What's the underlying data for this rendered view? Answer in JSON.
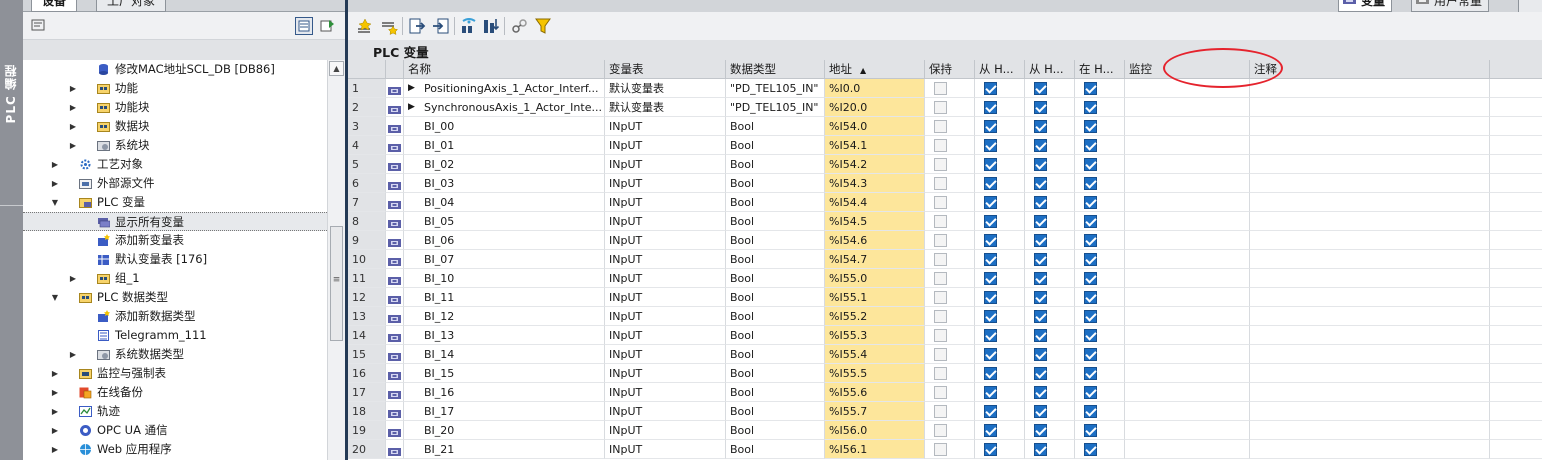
{
  "side_tab": {
    "label": "PLC 编程"
  },
  "left_tabs": {
    "devices": "设备",
    "tech_objects": "工厂对象"
  },
  "tree": [
    {
      "label": "修改MAC地址SCL_DB [DB86]",
      "indent": 3,
      "expand": "",
      "icon": "db-icon"
    },
    {
      "label": "功能",
      "indent": 3,
      "expand": "▶",
      "icon": "folder-icon"
    },
    {
      "label": "功能块",
      "indent": 3,
      "expand": "▶",
      "icon": "folder-icon"
    },
    {
      "label": "数据块",
      "indent": 3,
      "expand": "▶",
      "icon": "folder-icon"
    },
    {
      "label": "系统块",
      "indent": 3,
      "expand": "▶",
      "icon": "system-icon"
    },
    {
      "label": "工艺对象",
      "indent": 2,
      "expand": "▶",
      "icon": "tech-icon"
    },
    {
      "label": "外部源文件",
      "indent": 2,
      "expand": "▶",
      "icon": "file-icon"
    },
    {
      "label": "PLC 变量",
      "indent": 2,
      "expand": "▼",
      "icon": "tag-folder-icon"
    },
    {
      "label": "显示所有变量",
      "indent": 3,
      "expand": "",
      "icon": "tags-icon",
      "selected": true
    },
    {
      "label": "添加新变量表",
      "indent": 3,
      "expand": "",
      "icon": "add-table-icon"
    },
    {
      "label": "默认变量表 [176]",
      "indent": 3,
      "expand": "",
      "icon": "table-icon"
    },
    {
      "label": "组_1",
      "indent": 3,
      "expand": "▶",
      "icon": "folder-icon"
    },
    {
      "label": "PLC 数据类型",
      "indent": 2,
      "expand": "▼",
      "icon": "folder-icon"
    },
    {
      "label": "添加新数据类型",
      "indent": 3,
      "expand": "",
      "icon": "add-type-icon"
    },
    {
      "label": "Telegramm_111",
      "indent": 3,
      "expand": "",
      "icon": "type-icon"
    },
    {
      "label": "系统数据类型",
      "indent": 3,
      "expand": "▶",
      "icon": "system-icon"
    },
    {
      "label": "监控与强制表",
      "indent": 2,
      "expand": "▶",
      "icon": "watch-icon"
    },
    {
      "label": "在线备份",
      "indent": 2,
      "expand": "▶",
      "icon": "backup-icon"
    },
    {
      "label": "轨迹",
      "indent": 2,
      "expand": "▶",
      "icon": "trace-icon"
    },
    {
      "label": "OPC UA 通信",
      "indent": 2,
      "expand": "▶",
      "icon": "opc-icon"
    },
    {
      "label": "Web 应用程序",
      "indent": 2,
      "expand": "▶",
      "icon": "web-icon"
    }
  ],
  "right_tabs": {
    "tags": "变量",
    "user_constants": "用户常量"
  },
  "section_title": "PLC 变量",
  "columns": {
    "name": "名称",
    "table": "变量表",
    "type": "数据类型",
    "address": "地址",
    "retain": "保持",
    "from_hmi_1": "从 H...",
    "from_hmi_2": "从 H...",
    "in_hmi": "在 H...",
    "monitor": "监控",
    "comment": "注释"
  },
  "rows": [
    {
      "n": "1",
      "name": "PositioningAxis_1_Actor_Interf...",
      "expand": true,
      "table": "默认变量表",
      "type": "\"PD_TEL105_IN\"",
      "addr": "%I0.0"
    },
    {
      "n": "2",
      "name": "SynchronousAxis_1_Actor_Inte...",
      "expand": true,
      "table": "默认变量表",
      "type": "\"PD_TEL105_IN\"",
      "addr": "%I20.0"
    },
    {
      "n": "3",
      "name": "BI_00",
      "expand": false,
      "table": "INpUT",
      "type": "Bool",
      "addr": "%I54.0"
    },
    {
      "n": "4",
      "name": "BI_01",
      "expand": false,
      "table": "INpUT",
      "type": "Bool",
      "addr": "%I54.1"
    },
    {
      "n": "5",
      "name": "BI_02",
      "expand": false,
      "table": "INpUT",
      "type": "Bool",
      "addr": "%I54.2"
    },
    {
      "n": "6",
      "name": "BI_03",
      "expand": false,
      "table": "INpUT",
      "type": "Bool",
      "addr": "%I54.3"
    },
    {
      "n": "7",
      "name": "BI_04",
      "expand": false,
      "table": "INpUT",
      "type": "Bool",
      "addr": "%I54.4"
    },
    {
      "n": "8",
      "name": "BI_05",
      "expand": false,
      "table": "INpUT",
      "type": "Bool",
      "addr": "%I54.5"
    },
    {
      "n": "9",
      "name": "BI_06",
      "expand": false,
      "table": "INpUT",
      "type": "Bool",
      "addr": "%I54.6"
    },
    {
      "n": "10",
      "name": "BI_07",
      "expand": false,
      "table": "INpUT",
      "type": "Bool",
      "addr": "%I54.7"
    },
    {
      "n": "11",
      "name": "BI_10",
      "expand": false,
      "table": "INpUT",
      "type": "Bool",
      "addr": "%I55.0"
    },
    {
      "n": "12",
      "name": "BI_11",
      "expand": false,
      "table": "INpUT",
      "type": "Bool",
      "addr": "%I55.1"
    },
    {
      "n": "13",
      "name": "BI_12",
      "expand": false,
      "table": "INpUT",
      "type": "Bool",
      "addr": "%I55.2"
    },
    {
      "n": "14",
      "name": "BI_13",
      "expand": false,
      "table": "INpUT",
      "type": "Bool",
      "addr": "%I55.3"
    },
    {
      "n": "15",
      "name": "BI_14",
      "expand": false,
      "table": "INpUT",
      "type": "Bool",
      "addr": "%I55.4"
    },
    {
      "n": "16",
      "name": "BI_15",
      "expand": false,
      "table": "INpUT",
      "type": "Bool",
      "addr": "%I55.5"
    },
    {
      "n": "17",
      "name": "BI_16",
      "expand": false,
      "table": "INpUT",
      "type": "Bool",
      "addr": "%I55.6"
    },
    {
      "n": "18",
      "name": "BI_17",
      "expand": false,
      "table": "INpUT",
      "type": "Bool",
      "addr": "%I55.7"
    },
    {
      "n": "19",
      "name": "BI_20",
      "expand": false,
      "table": "INpUT",
      "type": "Bool",
      "addr": "%I56.0"
    },
    {
      "n": "20",
      "name": "BI_21",
      "expand": false,
      "table": "INpUT",
      "type": "Bool",
      "addr": "%I56.1"
    }
  ],
  "colors": {
    "address_highlight": "#fde69b",
    "checkbox_checked": "#1d6fc4",
    "annotation_ellipse": "#e5232d",
    "divider": "#243a55"
  }
}
